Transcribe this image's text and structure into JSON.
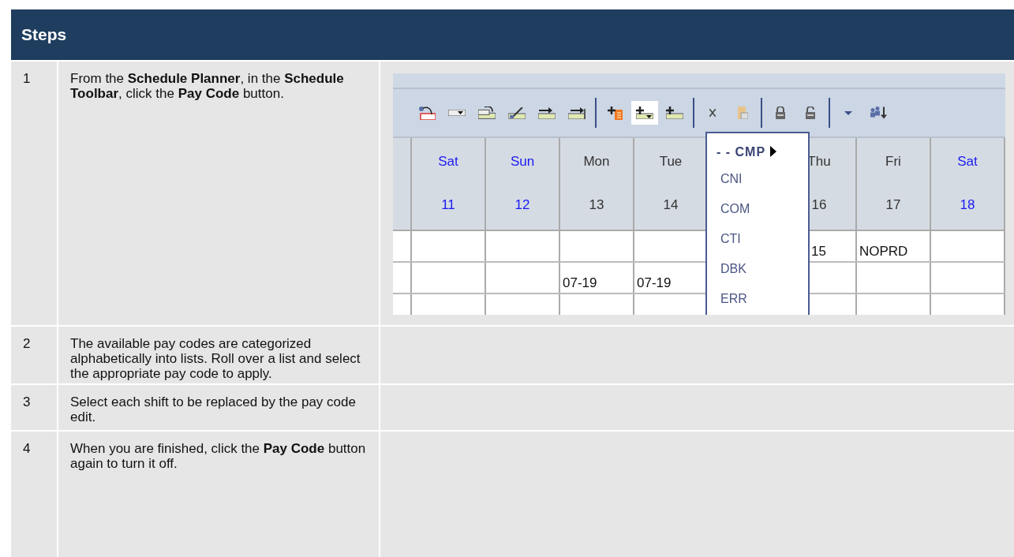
{
  "header": {
    "title": "Steps"
  },
  "steps": [
    {
      "number": "1",
      "text": "From the **Schedule Planner**, in the **Schedule Toolbar**, click the **Pay Code** button."
    },
    {
      "number": "2",
      "text": "The available pay codes are categorized alphabetically into lists. Roll over a list and select the appropriate pay code to apply."
    },
    {
      "number": "3",
      "text": "Select each shift to be replaced by the pay code edit."
    },
    {
      "number": "4",
      "text": "When you are finished, click the **Pay Code** button again to turn it off."
    }
  ],
  "screenshot": {
    "toolbar": {
      "groups": [
        {
          "buttons": [
            {
              "kind": "reassign",
              "hovered": false
            },
            {
              "kind": "dropdown",
              "hovered": false
            },
            {
              "kind": "swap",
              "hovered": false
            },
            {
              "kind": "edit",
              "hovered": false
            },
            {
              "kind": "insert",
              "hovered": false
            },
            {
              "kind": "append",
              "hovered": false
            }
          ]
        },
        {
          "buttons": [
            {
              "kind": "addnote",
              "hovered": false
            },
            {
              "kind": "paycode",
              "hovered": true
            },
            {
              "kind": "add",
              "hovered": false
            }
          ]
        },
        {
          "buttons": [
            {
              "kind": "delete",
              "hovered": false
            },
            {
              "kind": "paste",
              "hovered": false
            }
          ]
        },
        {
          "buttons": [
            {
              "kind": "lock",
              "hovered": false
            },
            {
              "kind": "unlock",
              "hovered": false
            }
          ]
        },
        {
          "buttons": [
            {
              "kind": "caret",
              "hovered": false
            },
            {
              "kind": "people",
              "hovered": false
            }
          ]
        }
      ]
    },
    "columns": [
      {
        "day": "Sat",
        "date": "11",
        "weekend": true
      },
      {
        "day": "Sun",
        "date": "12",
        "weekend": true
      },
      {
        "day": "Mon",
        "date": "13",
        "weekend": false
      },
      {
        "day": "Tue",
        "date": "14",
        "weekend": false
      },
      null,
      {
        "day": "Thu",
        "date": "16",
        "weekend": false
      },
      {
        "day": "Fri",
        "date": "17",
        "weekend": false
      },
      {
        "day": "Sat",
        "date": "18",
        "weekend": true
      }
    ],
    "rows": [
      [
        "",
        "",
        "",
        "",
        "",
        "15",
        "NOPRD",
        ""
      ],
      [
        "",
        "",
        "07-19",
        "07-19",
        "",
        "",
        "",
        ""
      ],
      [
        "",
        "",
        "",
        "",
        "",
        "",
        "",
        ""
      ]
    ],
    "menu": {
      "items": [
        {
          "label": "- - CMP",
          "kind": "submenu"
        },
        {
          "label": "CNI",
          "kind": "item"
        },
        {
          "label": "COM",
          "kind": "item"
        },
        {
          "label": "CTI",
          "kind": "item"
        },
        {
          "label": "DBK",
          "kind": "item"
        },
        {
          "label": "ERR",
          "kind": "item"
        }
      ]
    }
  }
}
